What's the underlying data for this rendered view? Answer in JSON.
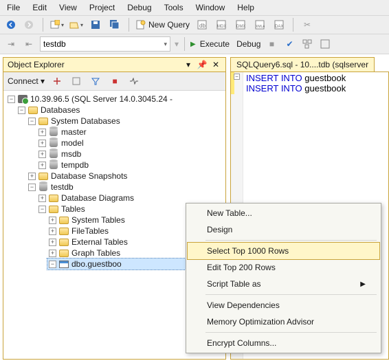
{
  "menubar": [
    "File",
    "Edit",
    "View",
    "Project",
    "Debug",
    "Tools",
    "Window",
    "Help"
  ],
  "toolbar": {
    "new_query": "New Query",
    "db_value": "testdb",
    "execute_label": "Execute",
    "debug_label": "Debug"
  },
  "explorer": {
    "title": "Object Explorer",
    "connect_label": "Connect",
    "server": "10.39.96.5 (SQL Server 14.0.3045.24 -",
    "databases": "Databases",
    "system_databases": "System Databases",
    "sys_db_items": [
      "master",
      "model",
      "msdb",
      "tempdb"
    ],
    "snapshots": "Database Snapshots",
    "user_db": "testdb",
    "diagrams": "Database Diagrams",
    "tables": "Tables",
    "table_subfolders": [
      "System Tables",
      "FileTables",
      "External Tables",
      "Graph Tables"
    ],
    "selected_table": "dbo.guestboo"
  },
  "editor": {
    "tab_title": "SQLQuery6.sql - 10....tdb (sqlserver",
    "line1_kw": "INSERT INTO",
    "line1_id": "guestbook",
    "line2_kw": "INSERT INTO",
    "line2_id": "guestbook"
  },
  "context_menu": {
    "items": [
      "New Table...",
      "Design",
      "Select Top 1000 Rows",
      "Edit Top 200 Rows",
      "Script Table as",
      "View Dependencies",
      "Memory Optimization Advisor",
      "Encrypt Columns..."
    ],
    "highlighted_index": 2,
    "submenu_index": 4,
    "separators_after": [
      1,
      4,
      6
    ]
  }
}
